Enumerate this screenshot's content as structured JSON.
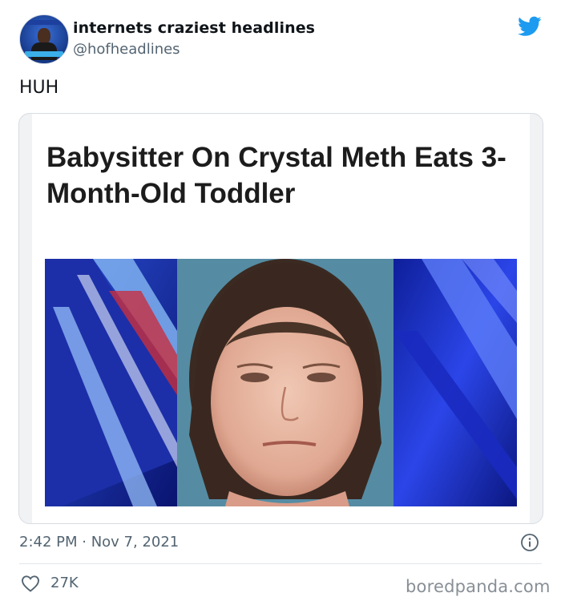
{
  "tweet": {
    "author_name": "internets craziest headlines",
    "author_handle": "@hofheadlines",
    "text": "HUH",
    "timestamp": "2:42 PM · Nov 7, 2021",
    "likes": "27K"
  },
  "card": {
    "headline": "Babysitter On Crystal Meth Eats 3-Month-Old Toddler"
  },
  "icons": {
    "brand": "twitter-bird-icon",
    "info": "info-icon",
    "like": "heart-icon"
  },
  "colors": {
    "twitter_blue": "#1d9bf0",
    "text_primary": "#0f1419",
    "text_secondary": "#536471"
  },
  "watermark": "boredpanda.com"
}
